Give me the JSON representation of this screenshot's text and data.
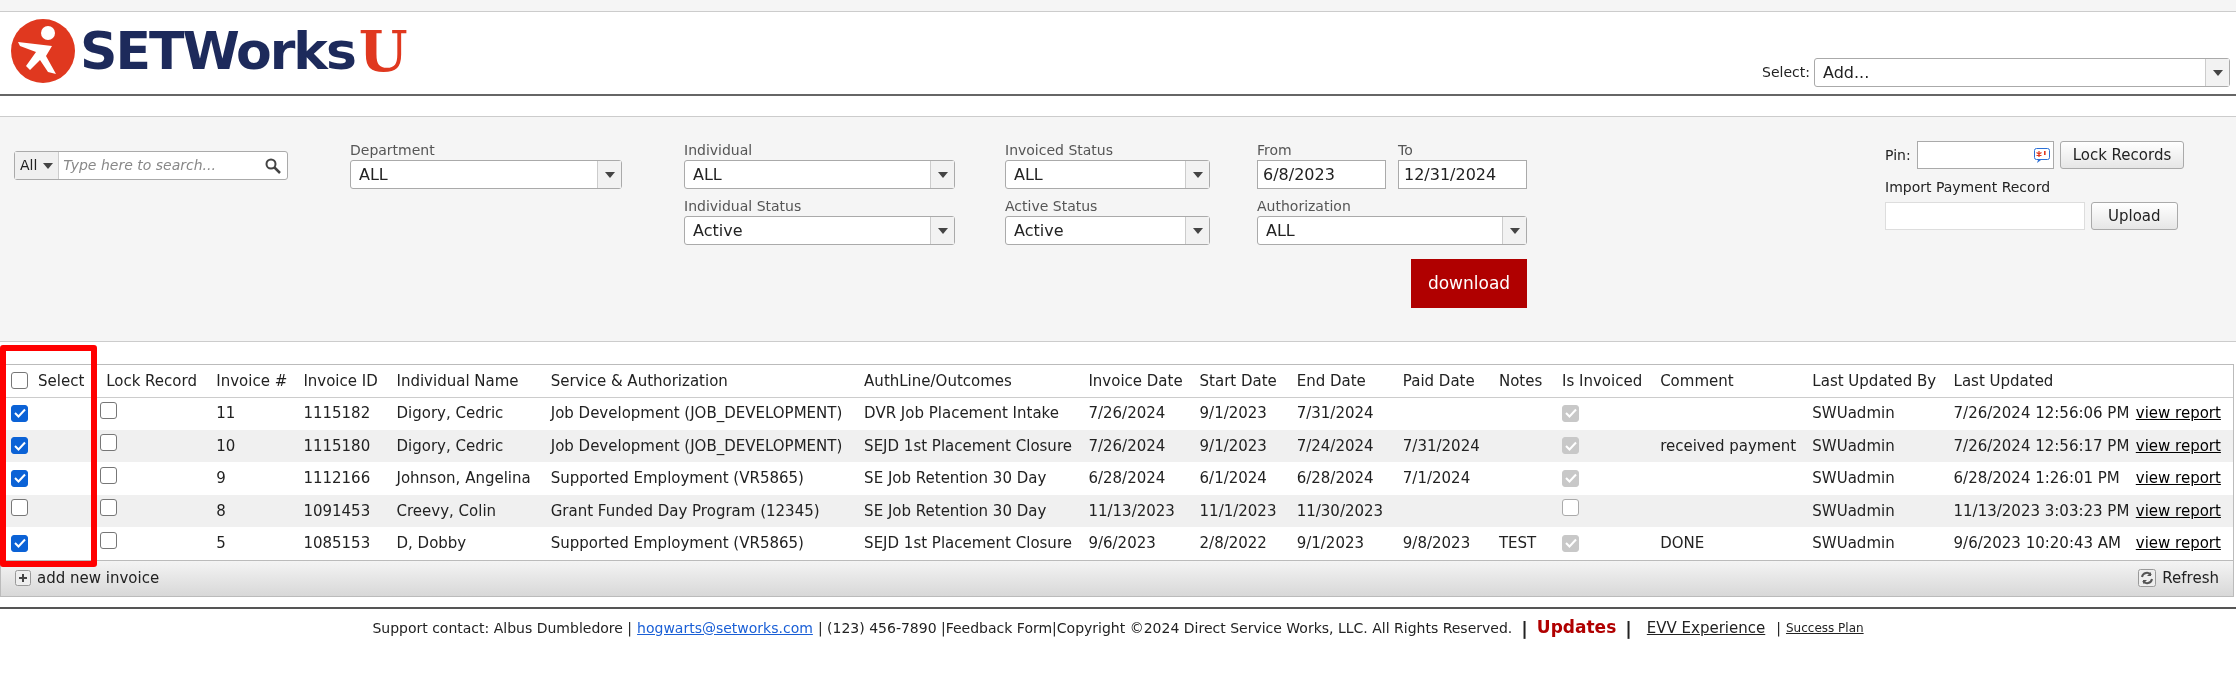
{
  "header": {
    "logo_text": "SETWorks",
    "logo_letter": "U",
    "select_label": "Select:",
    "select_value": "Add..."
  },
  "filters": {
    "search": {
      "scope": "All",
      "placeholder": "Type here to search..."
    },
    "column_1": [
      {
        "label": "Department",
        "value": "ALL"
      }
    ],
    "column_2": [
      {
        "label": "Individual",
        "value": "ALL"
      },
      {
        "label": "Individual Status",
        "value": "Active"
      }
    ],
    "column_3": [
      {
        "label": "Invoiced Status",
        "value": "ALL"
      },
      {
        "label": "Active Status",
        "value": "Active"
      }
    ],
    "from": {
      "label": "From",
      "value": "6/8/2023"
    },
    "to": {
      "label": "To",
      "value": "12/31/2024"
    },
    "authorization": {
      "label": "Authorization",
      "value": "ALL"
    },
    "download_button": "download",
    "pin_label": "Pin:",
    "lock_button": "Lock Records",
    "import_label": "Import Payment Record",
    "upload_button": "Upload"
  },
  "table": {
    "select_all_checked": false,
    "columns": [
      "Select",
      "Lock Record",
      "Invoice #",
      "Invoice ID",
      "Individual Name",
      "Service & Authorization",
      "AuthLine/Outcomes",
      "Invoice Date",
      "Start Date",
      "End Date",
      "Paid Date",
      "Notes",
      "Is Invoiced",
      "Comment",
      "Last Updated By",
      "Last Updated"
    ],
    "rows": [
      {
        "selected": true,
        "locked": false,
        "invoiced": true,
        "cells": [
          "",
          "",
          "11",
          "1115182",
          "Digory, Cedric",
          "Job Development (JOB_DEVELOPMENT)",
          "DVR Job Placement Intake",
          "7/26/2024",
          "9/1/2023",
          "7/31/2024",
          "",
          "",
          "",
          "",
          "SWUadmin",
          "7/26/2024 12:56:06 PM",
          "view report"
        ]
      },
      {
        "selected": true,
        "locked": false,
        "invoiced": true,
        "cells": [
          "",
          "",
          "10",
          "1115180",
          "Digory, Cedric",
          "Job Development (JOB_DEVELOPMENT)",
          "SEJD 1st Placement Closure",
          "7/26/2024",
          "9/1/2023",
          "7/24/2024",
          "7/31/2024",
          "",
          "",
          "received payment",
          "SWUadmin",
          "7/26/2024 12:56:17 PM",
          "view report"
        ]
      },
      {
        "selected": true,
        "locked": false,
        "invoiced": true,
        "cells": [
          "",
          "",
          "9",
          "1112166",
          "Johnson, Angelina",
          "Supported Employment (VR5865)",
          "SE Job Retention 30 Day",
          "6/28/2024",
          "6/1/2024",
          "6/28/2024",
          "7/1/2024",
          "",
          "",
          "",
          "SWUadmin",
          "6/28/2024 1:26:01 PM",
          "view report"
        ]
      },
      {
        "selected": false,
        "locked": false,
        "invoiced": false,
        "cells": [
          "",
          "",
          "8",
          "1091453",
          "Creevy, Colin",
          "Grant Funded Day Program (12345)",
          "SE Job Retention 30 Day",
          "11/13/2023",
          "11/1/2023",
          "11/30/2023",
          "",
          "",
          "",
          "",
          "SWUadmin",
          "11/13/2023 3:03:23 PM",
          "view report"
        ]
      },
      {
        "selected": true,
        "locked": false,
        "invoiced": true,
        "cells": [
          "",
          "",
          "5",
          "1085153",
          "D, Dobby",
          "Supported Employment (VR5865)",
          "SEJD 1st Placement Closure",
          "9/6/2023",
          "2/8/2022",
          "9/1/2023",
          "9/8/2023",
          "TEST",
          "",
          "DONE",
          "SWUadmin",
          "9/6/2023 10:20:43 AM",
          "view report"
        ]
      }
    ]
  },
  "grid_footer": {
    "add_label": "add new invoice",
    "refresh_label": "Refresh"
  },
  "footer": [
    {
      "kind": "text",
      "text": "Support contact: Albus Dumbledore |"
    },
    {
      "kind": "link",
      "text": "hogwarts@setworks.com"
    },
    {
      "kind": "text",
      "text": "| (123) 456-7890 |Feedback Form|Copyright ©2024 Direct Service Works, LLC. All Rights Reserved."
    },
    {
      "kind": "separator",
      "text": "|"
    },
    {
      "kind": "highlight",
      "text": "Updates"
    },
    {
      "kind": "separator",
      "text": "|"
    },
    {
      "kind": "plainlink",
      "text": "EVV Experience"
    },
    {
      "kind": "text",
      "text": "|"
    },
    {
      "kind": "smalllink",
      "text": "Success Plan"
    }
  ]
}
